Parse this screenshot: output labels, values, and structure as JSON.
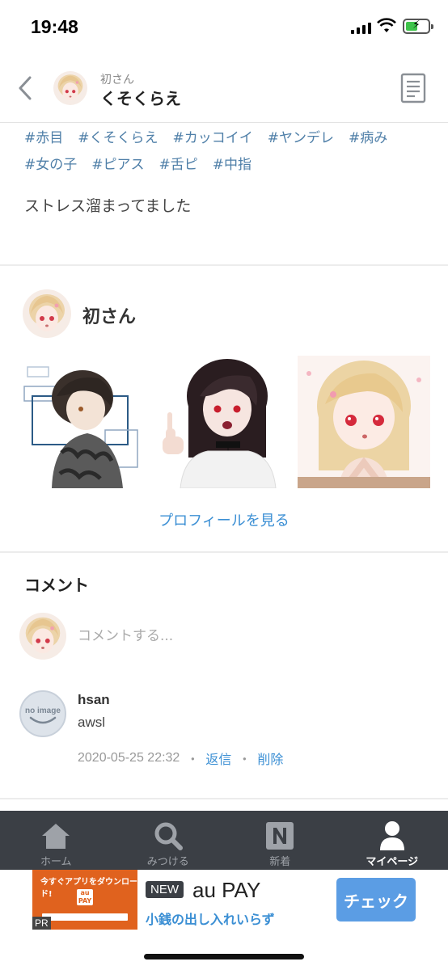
{
  "status_bar": {
    "time": "19:48"
  },
  "header": {
    "subtitle": "初さん",
    "title": "くそくらえ"
  },
  "tags": [
    [
      "#赤目",
      "#くそくらえ",
      "#カッコイイ",
      "#ヤンデレ",
      "#病み"
    ],
    [
      "#女の子",
      "#ピアス",
      "#舌ピ",
      "#中指"
    ]
  ],
  "post": {
    "caption": "ストレス溜まってました"
  },
  "profile": {
    "name": "初さん",
    "link_label": "プロフィールを見る"
  },
  "comments": {
    "title": "コメント",
    "input_placeholder": "コメントする...",
    "items": [
      {
        "user": "hsan",
        "text": "awsl",
        "timestamp": "2020-05-25 22:32",
        "reply_label": "返信",
        "delete_label": "削除"
      }
    ]
  },
  "tabbar": {
    "items": [
      {
        "label": "ホーム",
        "icon": "home-icon"
      },
      {
        "label": "みつける",
        "icon": "search-icon"
      },
      {
        "label": "新着",
        "icon": "new-icon"
      },
      {
        "label": "マイページ",
        "icon": "person-icon",
        "active": true
      }
    ]
  },
  "ad": {
    "image_text": "今すぐアプリをダウンロード!",
    "pr": "PR",
    "badge": "NEW",
    "brand": "au PAY",
    "tagline": "小銭の出し入れいらず",
    "cta": "チェック",
    "accent": "#e0621e"
  },
  "colors": {
    "link": "#3b8fd4",
    "tag": "#4f7fa8",
    "tabbar": "#3b3f45"
  }
}
